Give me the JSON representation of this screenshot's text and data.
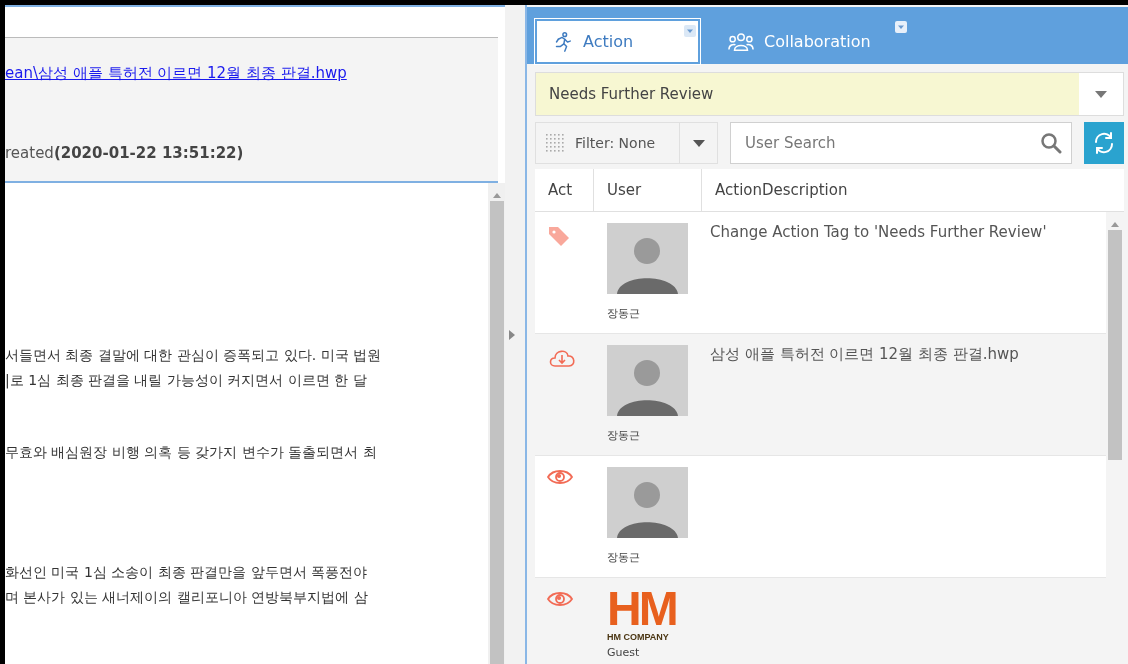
{
  "document": {
    "link": "ean\\삼성 애플 특허전 이르면 12월 최종 판결.hwp",
    "created": "reated**(2020-01-22 13:51:22)**",
    "paragraphs": [
      [
        "서들면서 최종 결말에 대한 관심이 증폭되고 있다. 미국 법원",
        "|로 1심 최종 판결을 내릴 가능성이 커지면서 이르면 한 달"
      ],
      [
        "무효와 배심원장 비행 의혹 등 갖가지 변수가 돌출되면서 최"
      ],
      [
        "화선인 미국 1심 소송이 최종 판결만을 앞두면서 폭풍전야",
        "며 본사가 있는 새너제이의 캘리포니아 연방북부지법에 삼"
      ]
    ]
  },
  "tabs": [
    {
      "label": "Action",
      "selected": true
    },
    {
      "label": "Collaboration",
      "selected": false
    }
  ],
  "tag_dropdown": {
    "value": "Needs Further Review"
  },
  "filter": {
    "label": "Filter: None"
  },
  "search": {
    "placeholder": "User Search"
  },
  "table": {
    "columns": [
      "Act",
      "User",
      "ActionDescription"
    ],
    "rows": [
      {
        "kind": "tag",
        "user": "장동근",
        "description": "Change Action Tag to 'Needs Further Review'"
      },
      {
        "kind": "download",
        "user": "장동근",
        "description": "삼성 애플 특허전 이르면 12월 최종 판결.hwp"
      },
      {
        "kind": "view",
        "user": "장동근"
      },
      {
        "kind": "view",
        "logo": {
          "mark": "HM",
          "caption": "HM COMPANY"
        },
        "user": "Guest"
      }
    ]
  }
}
